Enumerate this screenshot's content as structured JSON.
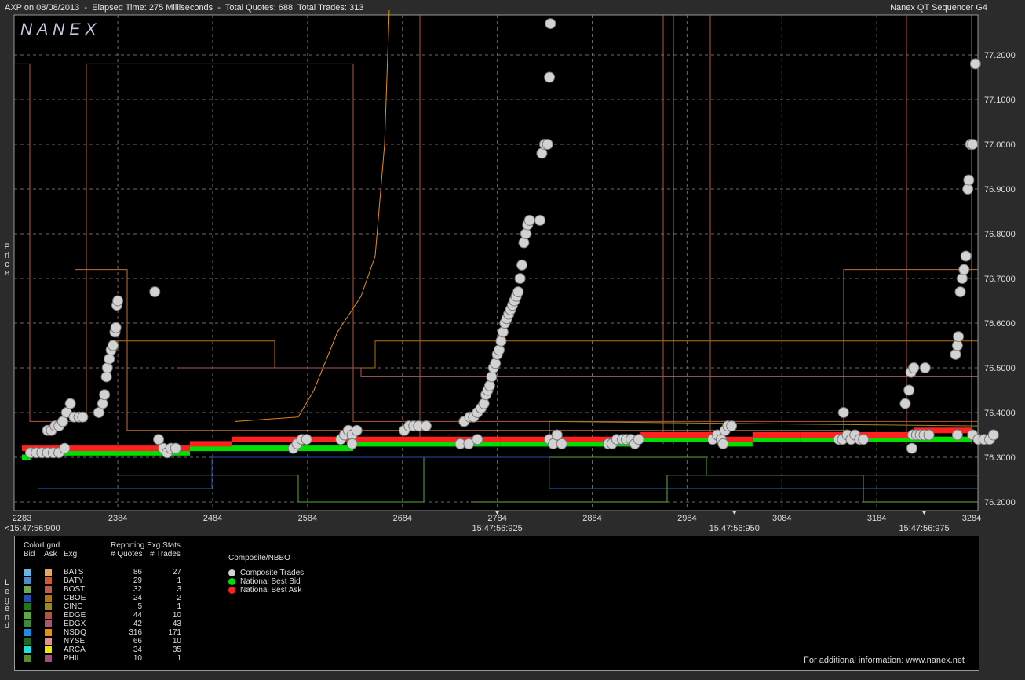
{
  "header": {
    "title_left": "AXP on 08/08/2013  -  Elapsed Time: 275 Milliseconds  -  Total Quotes: 688  Total Trades: 313",
    "title_right": "Nanex QT Sequencer G4"
  },
  "logo_text": "NANEX",
  "y_axis_title": "Price",
  "legend_axis_title": "Legend",
  "chart_data": {
    "type": "scatter",
    "title": "AXP on 08/08/2013",
    "xlim": [
      2283,
      3284
    ],
    "ylim": [
      76.18,
      77.3
    ],
    "y_ticks": [
      "77.2000",
      "77.1000",
      "77.0000",
      "76.9000",
      "76.8000",
      "76.7000",
      "76.6000",
      "76.5000",
      "76.4000",
      "76.3000",
      "76.2000"
    ],
    "x_ticks": [
      "2283",
      "2384",
      "2484",
      "2584",
      "2684",
      "2784",
      "2884",
      "2984",
      "3084",
      "3184",
      "3284"
    ],
    "time_labels": [
      {
        "x": 2283,
        "label": "<15:47:56:900"
      },
      {
        "x": 2784,
        "label": "15:47:56:925"
      },
      {
        "x": 3034,
        "label": "15:47:56:950"
      },
      {
        "x": 3234,
        "label": "15:47:56:975"
      }
    ],
    "series": [
      {
        "name": "Composite Trades",
        "color": "#d2d2d2",
        "points": [
          [
            2310,
            76.36
          ],
          [
            2314,
            76.36
          ],
          [
            2318,
            76.37
          ],
          [
            2322,
            76.37
          ],
          [
            2326,
            76.38
          ],
          [
            2330,
            76.4
          ],
          [
            2334,
            76.42
          ],
          [
            2338,
            76.39
          ],
          [
            2343,
            76.39
          ],
          [
            2347,
            76.39
          ],
          [
            2292,
            76.31
          ],
          [
            2298,
            76.31
          ],
          [
            2304,
            76.31
          ],
          [
            2310,
            76.31
          ],
          [
            2316,
            76.31
          ],
          [
            2322,
            76.31
          ],
          [
            2328,
            76.32
          ],
          [
            2364,
            76.4
          ],
          [
            2368,
            76.42
          ],
          [
            2370,
            76.44
          ],
          [
            2372,
            76.48
          ],
          [
            2373,
            76.5
          ],
          [
            2375,
            76.52
          ],
          [
            2377,
            76.54
          ],
          [
            2379,
            76.55
          ],
          [
            2381,
            76.58
          ],
          [
            2382,
            76.59
          ],
          [
            2383,
            76.64
          ],
          [
            2384,
            76.65
          ],
          [
            2423,
            76.67
          ],
          [
            2427,
            76.34
          ],
          [
            2432,
            76.32
          ],
          [
            2436,
            76.31
          ],
          [
            2440,
            76.32
          ],
          [
            2445,
            76.32
          ],
          [
            2569,
            76.32
          ],
          [
            2573,
            76.33
          ],
          [
            2578,
            76.34
          ],
          [
            2583,
            76.34
          ],
          [
            2619,
            76.34
          ],
          [
            2623,
            76.35
          ],
          [
            2627,
            76.36
          ],
          [
            2631,
            76.35
          ],
          [
            2636,
            76.36
          ],
          [
            2631,
            76.33
          ],
          [
            2686,
            76.36
          ],
          [
            2691,
            76.37
          ],
          [
            2696,
            76.37
          ],
          [
            2701,
            76.37
          ],
          [
            2709,
            76.37
          ],
          [
            2749,
            76.38
          ],
          [
            2755,
            76.39
          ],
          [
            2759,
            76.39
          ],
          [
            2763,
            76.4
          ],
          [
            2767,
            76.41
          ],
          [
            2770,
            76.42
          ],
          [
            2772,
            76.44
          ],
          [
            2774,
            76.45
          ],
          [
            2776,
            76.46
          ],
          [
            2778,
            76.48
          ],
          [
            2780,
            76.5
          ],
          [
            2782,
            76.51
          ],
          [
            2784,
            76.53
          ],
          [
            2786,
            76.54
          ],
          [
            2788,
            76.56
          ],
          [
            2790,
            76.58
          ],
          [
            2792,
            76.6
          ],
          [
            2794,
            76.61
          ],
          [
            2796,
            76.62
          ],
          [
            2798,
            76.63
          ],
          [
            2800,
            76.64
          ],
          [
            2802,
            76.65
          ],
          [
            2804,
            76.66
          ],
          [
            2806,
            76.67
          ],
          [
            2808,
            76.7
          ],
          [
            2810,
            76.73
          ],
          [
            2812,
            76.78
          ],
          [
            2814,
            76.8
          ],
          [
            2816,
            76.82
          ],
          [
            2818,
            76.83
          ],
          [
            2745,
            76.33
          ],
          [
            2754,
            76.33
          ],
          [
            2763,
            76.34
          ],
          [
            2829,
            76.83
          ],
          [
            2831,
            76.98
          ],
          [
            2834,
            77.0
          ],
          [
            2837,
            77.0
          ],
          [
            2839,
            77.15
          ],
          [
            2840,
            77.27
          ],
          [
            2839,
            76.34
          ],
          [
            2843,
            76.33
          ],
          [
            2847,
            76.35
          ],
          [
            2852,
            76.33
          ],
          [
            2901,
            76.33
          ],
          [
            2905,
            76.33
          ],
          [
            2910,
            76.34
          ],
          [
            2916,
            76.34
          ],
          [
            2920,
            76.34
          ],
          [
            2925,
            76.34
          ],
          [
            2929,
            76.33
          ],
          [
            2933,
            76.34
          ],
          [
            3011,
            76.34
          ],
          [
            3016,
            76.35
          ],
          [
            3020,
            76.34
          ],
          [
            3024,
            76.36
          ],
          [
            3027,
            76.37
          ],
          [
            3031,
            76.37
          ],
          [
            3022,
            76.33
          ],
          [
            3149,
            76.4
          ],
          [
            3144,
            76.34
          ],
          [
            3148,
            76.34
          ],
          [
            3153,
            76.35
          ],
          [
            3157,
            76.34
          ],
          [
            3161,
            76.35
          ],
          [
            3166,
            76.34
          ],
          [
            3170,
            76.34
          ],
          [
            3214,
            76.42
          ],
          [
            3218,
            76.45
          ],
          [
            3220,
            76.49
          ],
          [
            3223,
            76.5
          ],
          [
            3235,
            76.5
          ],
          [
            3221,
            76.32
          ],
          [
            3222,
            76.35
          ],
          [
            3226,
            76.35
          ],
          [
            3230,
            76.35
          ],
          [
            3234,
            76.35
          ],
          [
            3239,
            76.35
          ],
          [
            3267,
            76.53
          ],
          [
            3269,
            76.55
          ],
          [
            3270,
            76.57
          ],
          [
            3272,
            76.67
          ],
          [
            3274,
            76.7
          ],
          [
            3276,
            76.72
          ],
          [
            3278,
            76.75
          ],
          [
            3280,
            76.9
          ],
          [
            3281,
            76.92
          ],
          [
            3283,
            77.0
          ],
          [
            3285,
            77.0
          ],
          [
            3288,
            77.18
          ],
          [
            3269,
            76.35
          ],
          [
            3285,
            76.35
          ],
          [
            3291,
            76.34
          ],
          [
            3297,
            76.34
          ],
          [
            3303,
            76.34
          ],
          [
            3307,
            76.35
          ]
        ]
      },
      {
        "name": "National Best Bid",
        "color": "#00e000",
        "steps": [
          [
            2283,
            76.3
          ],
          [
            2292,
            76.31
          ],
          [
            2384,
            76.31
          ],
          [
            2420,
            76.31
          ],
          [
            2460,
            76.32
          ],
          [
            2504,
            76.32
          ],
          [
            2584,
            76.32
          ],
          [
            2632,
            76.33
          ],
          [
            2742,
            76.33
          ],
          [
            2787,
            76.33
          ],
          [
            2847,
            76.33
          ],
          [
            2935,
            76.34
          ],
          [
            3023,
            76.33
          ],
          [
            3053,
            76.34
          ],
          [
            3103,
            76.34
          ],
          [
            3160,
            76.34
          ],
          [
            3284,
            76.34
          ]
        ]
      },
      {
        "name": "National Best Ask",
        "color": "#ff2020",
        "steps": [
          [
            2283,
            76.32
          ],
          [
            2300,
            76.32
          ],
          [
            2384,
            76.32
          ],
          [
            2460,
            76.33
          ],
          [
            2504,
            76.34
          ],
          [
            2584,
            76.34
          ],
          [
            2632,
            76.34
          ],
          [
            2742,
            76.34
          ],
          [
            2787,
            76.34
          ],
          [
            2847,
            76.34
          ],
          [
            2935,
            76.35
          ],
          [
            3023,
            76.34
          ],
          [
            3053,
            76.35
          ],
          [
            3103,
            76.35
          ],
          [
            3160,
            76.35
          ],
          [
            3223,
            76.36
          ],
          [
            3284,
            76.35
          ]
        ]
      }
    ]
  },
  "legend": {
    "colorlegend_title": "ColorLgnd",
    "bid_header": "Bid",
    "ask_header": "Ask",
    "exg_header": "Exg",
    "stats_title": "Reporting Exg Stats",
    "quotes_header": "# Quotes",
    "trades_header": "# Trades",
    "composite_title": "Composite/NBBO",
    "rows": [
      {
        "exg": "BATS",
        "quotes": "86",
        "trades": "27",
        "bid_color": "#6ab4e6",
        "ask_color": "#e8a860"
      },
      {
        "exg": "BATY",
        "quotes": "29",
        "trades": "1",
        "bid_color": "#4a8cc8",
        "ask_color": "#d8572a"
      },
      {
        "exg": "BOST",
        "quotes": "32",
        "trades": "3",
        "bid_color": "#6ea94a",
        "ask_color": "#c05a4a"
      },
      {
        "exg": "CBOE",
        "quotes": "24",
        "trades": "2",
        "bid_color": "#2050b0",
        "ask_color": "#b8740c"
      },
      {
        "exg": "CINC",
        "quotes": "5",
        "trades": "1",
        "bid_color": "#1a7a1a",
        "ask_color": "#9a8a20"
      },
      {
        "exg": "EDGE",
        "quotes": "44",
        "trades": "10",
        "bid_color": "#5caa3c",
        "ask_color": "#b8543c"
      },
      {
        "exg": "EDGX",
        "quotes": "42",
        "trades": "43",
        "bid_color": "#3a8a3a",
        "ask_color": "#a8586a"
      },
      {
        "exg": "NSDQ",
        "quotes": "316",
        "trades": "171",
        "bid_color": "#1c8ee6",
        "ask_color": "#e8900c"
      },
      {
        "exg": "NYSE",
        "quotes": "66",
        "trades": "10",
        "bid_color": "#1e6a1e",
        "ask_color": "#e09090"
      },
      {
        "exg": "ARCA",
        "quotes": "34",
        "trades": "35",
        "bid_color": "#1ee0e0",
        "ask_color": "#e8e800"
      },
      {
        "exg": "PHIL",
        "quotes": "10",
        "trades": "1",
        "bid_color": "#5a8a2a",
        "ask_color": "#a0507a"
      }
    ],
    "composite_items": [
      {
        "label": "Composite Trades",
        "color": "#d2d2d2"
      },
      {
        "label": "National Best Bid",
        "color": "#00e000"
      },
      {
        "label": "National Best Ask",
        "color": "#ff2020"
      }
    ],
    "footer": "For additional information: www.nanex.net"
  }
}
